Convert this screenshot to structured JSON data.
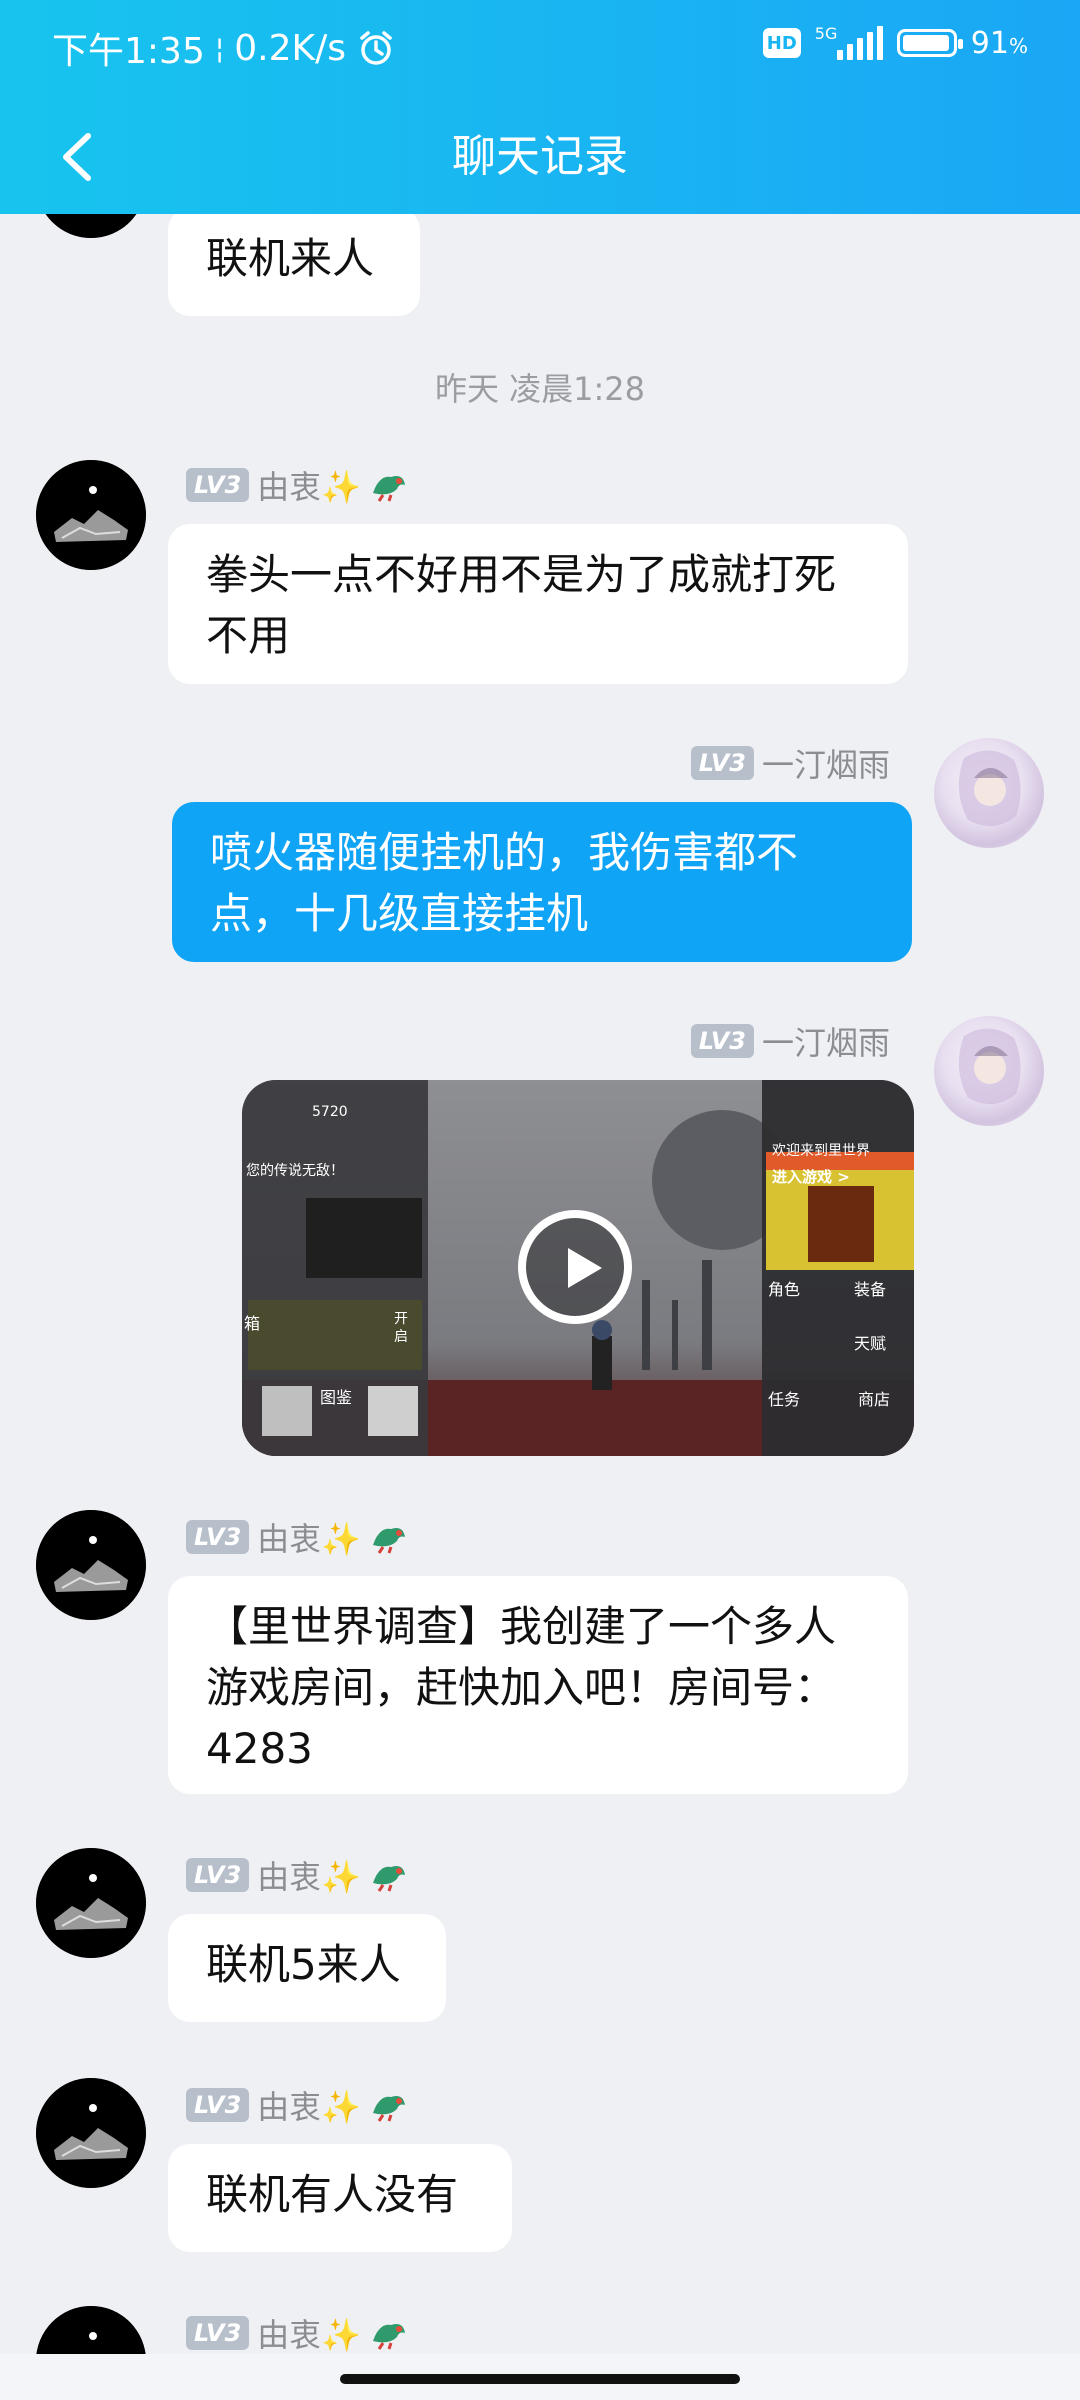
{
  "status_bar": {
    "time": "下午1:35",
    "separator": "¦",
    "speed": "0.2K/s",
    "alarm_icon": "alarm-icon",
    "hd": "HD",
    "network": "5G",
    "battery": "91",
    "battery_unit": "%"
  },
  "nav": {
    "title": "聊天记录",
    "back_icon": "chevron-left-icon"
  },
  "timestamp": "昨天 凌晨1:28",
  "messages": [
    {
      "sender": "由衷✨",
      "level": "LV3",
      "text": "联机来人"
    },
    {
      "sender": "由衷✨",
      "level": "LV3",
      "text": "拳头一点不好用不是为了成就打死不用"
    },
    {
      "sender": "一汀烟雨",
      "level": "LV3",
      "text": "喷火器随便挂机的，我伤害都不点，十几级直接挂机"
    },
    {
      "sender": "一汀烟雨",
      "level": "LV3",
      "text": ""
    },
    {
      "sender": "由衷✨",
      "level": "LV3",
      "text": "【里世界调查】我创建了一个多人游戏房间，赶快加入吧！房间号：4283"
    },
    {
      "sender": "由衷✨",
      "level": "LV3",
      "text": "联机5来人"
    },
    {
      "sender": "由衷✨",
      "level": "LV3",
      "text": "联机有人没有"
    },
    {
      "sender": "由衷✨",
      "level": "LV3",
      "text": ""
    }
  ],
  "video_card": {
    "score": "5720",
    "mission_text": "您的传说无敌！",
    "welcome": "欢迎来到里世界",
    "enter_game": "进入游戏 >",
    "menu": [
      "角色",
      "装备",
      "天赋",
      "任务",
      "商店"
    ],
    "box": "箱",
    "open_key": "开启",
    "gallery": "图鉴",
    "play_icon": "play-icon"
  },
  "colors": {
    "header": "#18b5f4",
    "my_bubble": "#10a4f6",
    "background": "#eff0f4"
  }
}
